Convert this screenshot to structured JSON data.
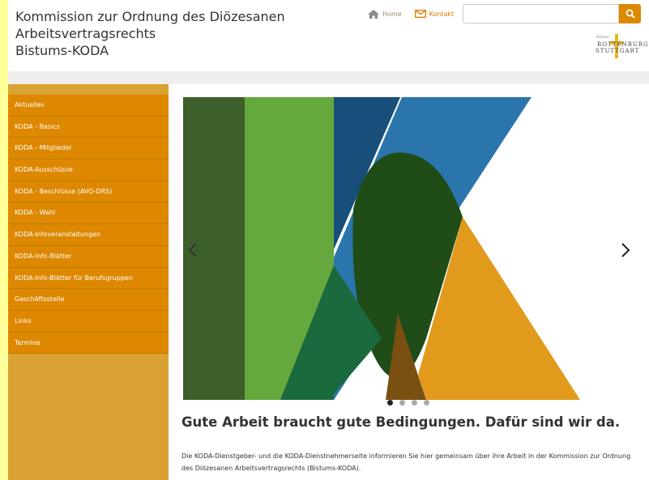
{
  "header": {
    "title_lines": [
      "Kommission zur Ordnung des Diözesanen",
      "Arbeitsvertragsrechts",
      "Bistums-KODA"
    ],
    "nav": {
      "home_label": "Home",
      "contact_label": "Kontakt"
    },
    "search": {
      "value": "",
      "placeholder": ""
    },
    "logo": {
      "small_text": "Diözese",
      "line1": "ROTTENBURG-",
      "line2": "STUTTGART"
    }
  },
  "sidebar": {
    "items": [
      {
        "label": "Aktuelles"
      },
      {
        "label": "KODA - Basics"
      },
      {
        "label": "KODA - Mitglieder"
      },
      {
        "label": "KODA-Ausschüsse"
      },
      {
        "label": "KODA - Beschlüsse (AVO-DRS)"
      },
      {
        "label": "KODA - Wahl"
      },
      {
        "label": "KODA-Infoveranstaltungen"
      },
      {
        "label": "KODA-Info-Blätter"
      },
      {
        "label": "KODA-Info-Blätter für Berufsgruppen"
      },
      {
        "label": "Geschäftsstelle"
      },
      {
        "label": "Links"
      },
      {
        "label": "Termine"
      }
    ]
  },
  "carousel": {
    "slide_count": 4,
    "active_index": 0
  },
  "main": {
    "headline": "Gute Arbeit braucht gute Bedingungen. Dafür sind wir da.",
    "intro": "Die KODA-Dienstgeber- und die KODA-Dienstnehmerseite informieren Sie hier gemeinsam über ihre Arbeit in der Kommission zur Ordnung des Diözesanen Arbeitsvertragsrechts (Bistums-KODA)."
  },
  "colors": {
    "accent": "#dd8800",
    "sidebar_bg": "#d9a233",
    "page_bg": "#ffff99"
  },
  "icons": {
    "home": "home-icon",
    "contact": "envelope-icon",
    "search": "search-icon",
    "prev": "chevron-left-icon",
    "next": "chevron-right-icon"
  }
}
